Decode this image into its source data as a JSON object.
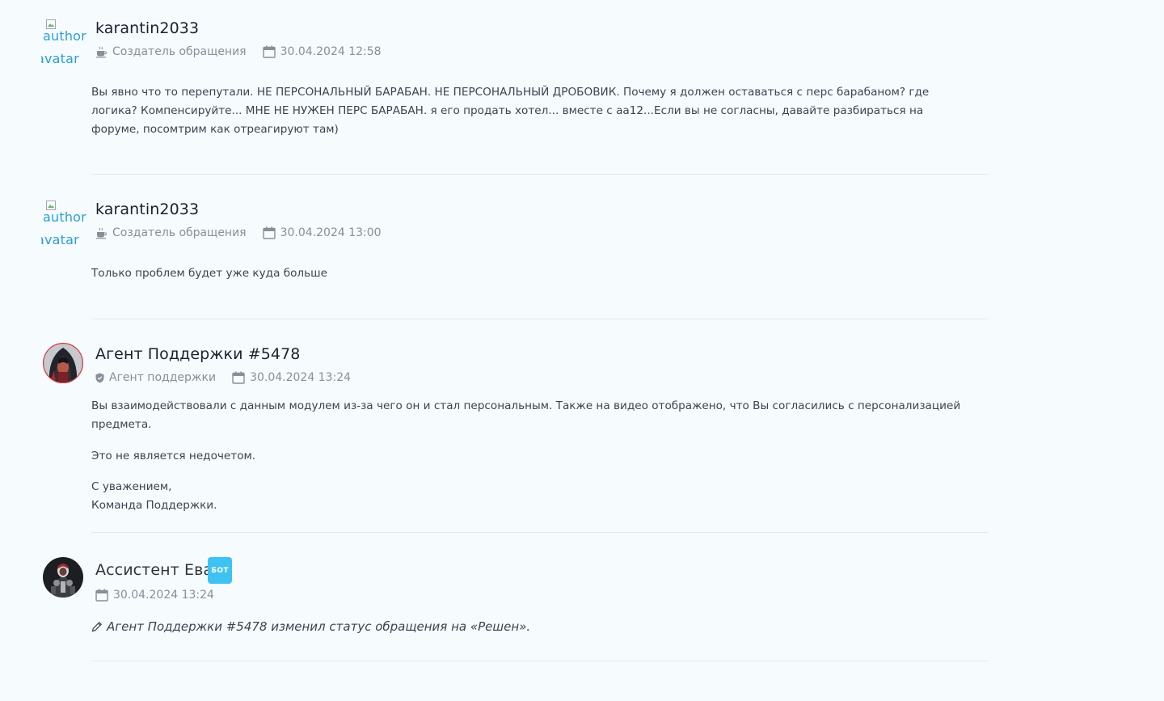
{
  "posts": [
    {
      "author": "karantin2033",
      "avatar_alt_1": "author",
      "avatar_alt_2": "avatar",
      "role": "Создатель обращения",
      "role_icon": "coffee-icon",
      "date": "30.04.2024 12:58",
      "paragraphs": [
        "Вы явно что то перепутали. НЕ ПЕРСОНАЛЬНЫЙ БАРАБАН. НЕ ПЕРСОНАЛЬНЫЙ ДРОБОВИК. Почему я должен оставаться с перс барабаном? где логика? Компенсируйте... МНЕ НЕ НУЖЕН ПЕРС БАРАБАН. я его продать хотел... вместе с аа12...Если вы не согласны, давайте разбираться на форуме, посомтрим как отреагируют там)"
      ]
    },
    {
      "author": "karantin2033",
      "avatar_alt_1": "author",
      "avatar_alt_2": "avatar",
      "role": "Создатель обращения",
      "role_icon": "coffee-icon",
      "date": "30.04.2024 13:00",
      "paragraphs": [
        "Только проблем будет уже куда больше"
      ]
    },
    {
      "author": "Агент Поддержки #5478",
      "role": "Агент поддержки",
      "role_icon": "shield-icon",
      "date": "30.04.2024 13:24",
      "paragraphs": [
        "Вы взаимодействовали с данным модулем из-за чего он и стал персональным. Также на видео отображено, что Вы согласились с персонализацией предмета.",
        "Это не является недочетом.",
        "С уважением,",
        "Команда Поддержки."
      ]
    },
    {
      "author": "Ассистент Ева",
      "badge": "БОТ",
      "date": "30.04.2024 13:24",
      "status_note": "Агент Поддержки #5478 изменил статус обращения на «Решен»."
    }
  ],
  "colors": {
    "background": "#f6fbfe",
    "bot_badge": "#3ec2f2",
    "link_alt_text": "#2a9fd6",
    "meta_text": "#8a8e9a",
    "divider": "#e4e8ee"
  }
}
